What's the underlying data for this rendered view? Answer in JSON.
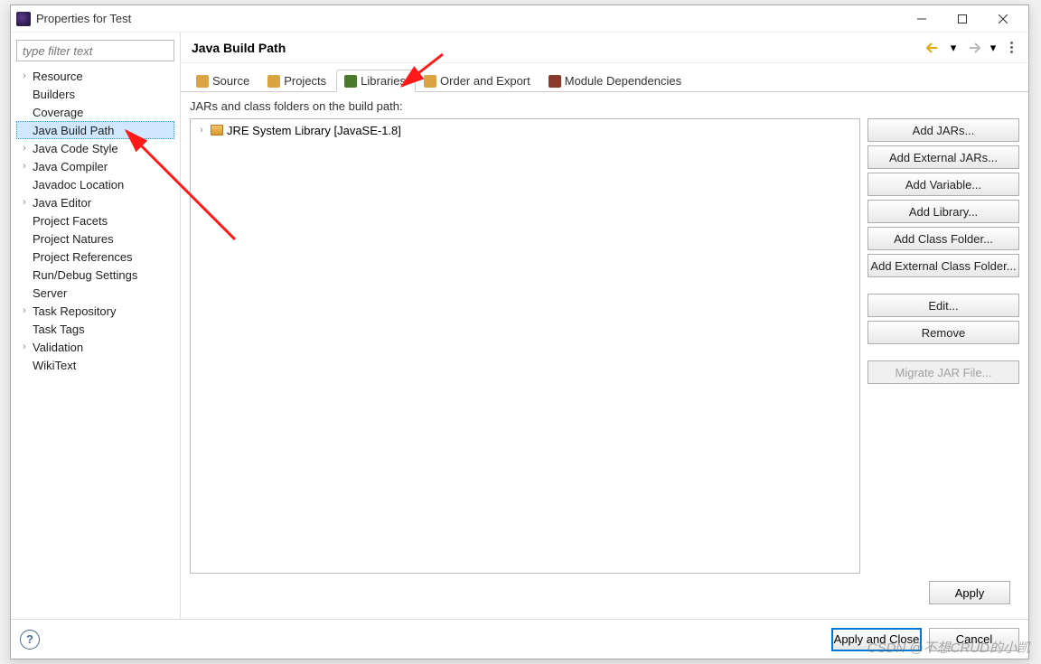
{
  "window": {
    "title": "Properties for Test"
  },
  "filter": {
    "placeholder": "type filter text"
  },
  "tree": [
    {
      "label": "Resource",
      "expandable": true
    },
    {
      "label": "Builders",
      "expandable": false
    },
    {
      "label": "Coverage",
      "expandable": false
    },
    {
      "label": "Java Build Path",
      "expandable": false,
      "selected": true
    },
    {
      "label": "Java Code Style",
      "expandable": true
    },
    {
      "label": "Java Compiler",
      "expandable": true
    },
    {
      "label": "Javadoc Location",
      "expandable": false
    },
    {
      "label": "Java Editor",
      "expandable": true
    },
    {
      "label": "Project Facets",
      "expandable": false
    },
    {
      "label": "Project Natures",
      "expandable": false
    },
    {
      "label": "Project References",
      "expandable": false
    },
    {
      "label": "Run/Debug Settings",
      "expandable": false
    },
    {
      "label": "Server",
      "expandable": false
    },
    {
      "label": "Task Repository",
      "expandable": true
    },
    {
      "label": "Task Tags",
      "expandable": false
    },
    {
      "label": "Validation",
      "expandable": true
    },
    {
      "label": "WikiText",
      "expandable": false
    }
  ],
  "page": {
    "title": "Java Build Path"
  },
  "tabs": [
    {
      "label": "Source",
      "icon": "source-icon",
      "color": "#d9a441"
    },
    {
      "label": "Projects",
      "icon": "projects-icon",
      "color": "#d9a441"
    },
    {
      "label": "Libraries",
      "icon": "libraries-icon",
      "color": "#4a7a2a",
      "active": true
    },
    {
      "label": "Order and Export",
      "icon": "order-icon",
      "color": "#d9a441"
    },
    {
      "label": "Module Dependencies",
      "icon": "module-icon",
      "color": "#8a3a2a"
    }
  ],
  "desc": "JARs and class folders on the build path:",
  "libs": [
    {
      "label": "JRE System Library [JavaSE-1.8]"
    }
  ],
  "buttons": {
    "addJars": "Add JARs...",
    "addExtJars": "Add External JARs...",
    "addVar": "Add Variable...",
    "addLib": "Add Library...",
    "addClassFolder": "Add Class Folder...",
    "addExtClassFolder": "Add External Class Folder...",
    "edit": "Edit...",
    "remove": "Remove",
    "migrate": "Migrate JAR File..."
  },
  "apply": "Apply",
  "footer": {
    "applyClose": "Apply and Close",
    "cancel": "Cancel"
  },
  "watermark": "CSDN @不想CRUD的小凯"
}
